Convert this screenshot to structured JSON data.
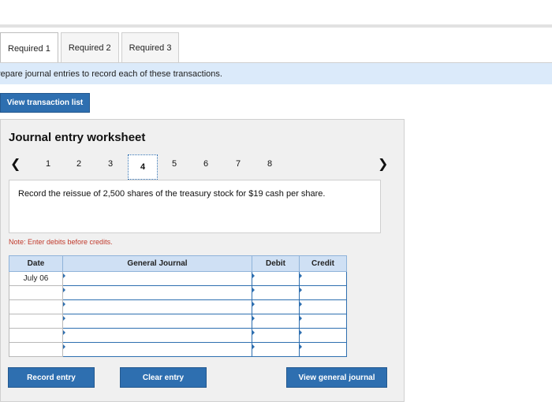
{
  "tabs": [
    "Required 1",
    "Required 2",
    "Required 3"
  ],
  "banner": {
    "text": "repare journal entries to record each of these transactions."
  },
  "view_transaction_list": "View transaction list",
  "worksheet": {
    "title": "Journal entry worksheet",
    "pages": [
      "1",
      "2",
      "3",
      "4",
      "5",
      "6",
      "7",
      "8"
    ],
    "active_page": "4",
    "prev_icon": "chevron-left-icon",
    "next_icon": "chevron-right-icon",
    "description": "Record the reissue of 2,500 shares of the treasury stock for $19 cash per share.",
    "note": "Note: Enter debits before credits."
  },
  "table": {
    "headers": [
      "Date",
      "General Journal",
      "Debit",
      "Credit"
    ],
    "rows": [
      {
        "date": "July 06"
      },
      {
        "date": ""
      },
      {
        "date": ""
      },
      {
        "date": ""
      },
      {
        "date": ""
      },
      {
        "date": ""
      }
    ]
  },
  "buttons": {
    "record": "Record entry",
    "clear": "Clear entry",
    "view_general_journal": "View general journal"
  },
  "colors": {
    "accent": "#2e6fb0",
    "banner": "#dbeafa",
    "header": "#cfe0f4",
    "note": "#c0392b"
  }
}
